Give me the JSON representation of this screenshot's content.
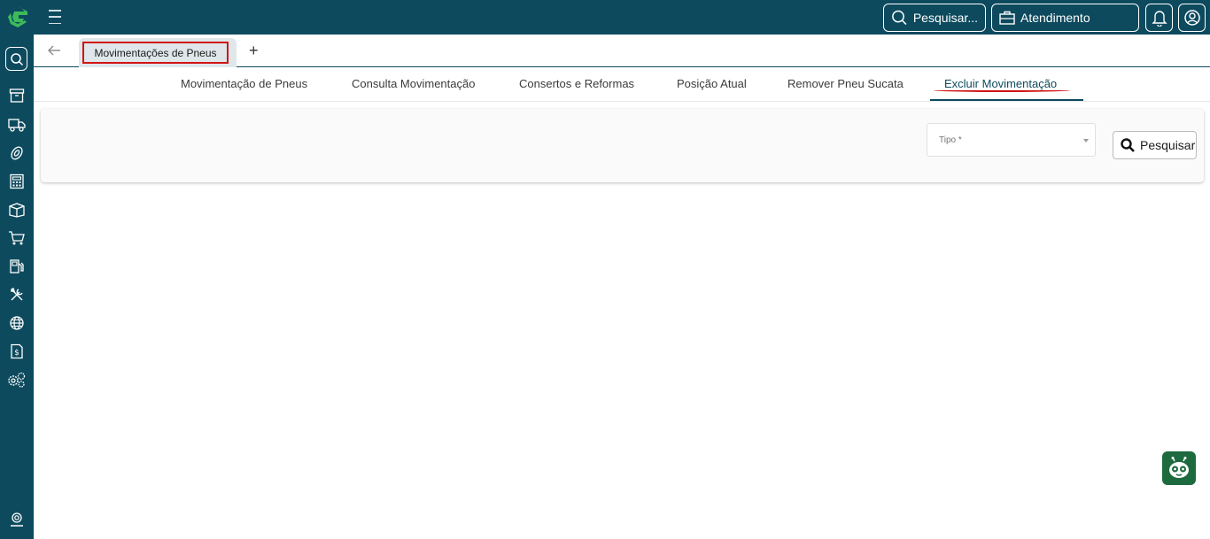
{
  "app": {
    "colors": {
      "primary": "#0d4a5e",
      "accent_red": "#d11414",
      "bot": "#1d6a3f"
    },
    "logo_icon": "g-logo-icon"
  },
  "rail": {
    "icons": [
      "search-icon",
      "archive-icon",
      "truck-icon",
      "tire-icon",
      "calculator-icon",
      "box-icon",
      "cart-icon",
      "fuel-pump-icon",
      "tools-icon",
      "globe-icon",
      "invoice-icon",
      "settings-icon",
      "support-icon"
    ]
  },
  "topbar": {
    "search_label": "Pesquisar...",
    "atendimento_label": "Atendimento"
  },
  "tabs": {
    "active_label": "Movimentações de Pneus",
    "add_label": "+"
  },
  "subnav": {
    "items": [
      {
        "label": "Movimentação de Pneus"
      },
      {
        "label": "Consulta Movimentação"
      },
      {
        "label": "Consertos e Reformas"
      },
      {
        "label": "Posição Atual"
      },
      {
        "label": "Remover Pneu Sucata"
      },
      {
        "label": "Excluir Movimentação"
      }
    ]
  },
  "filters": {
    "tipo_label": "Tipo *",
    "search_button": "Pesquisar"
  }
}
